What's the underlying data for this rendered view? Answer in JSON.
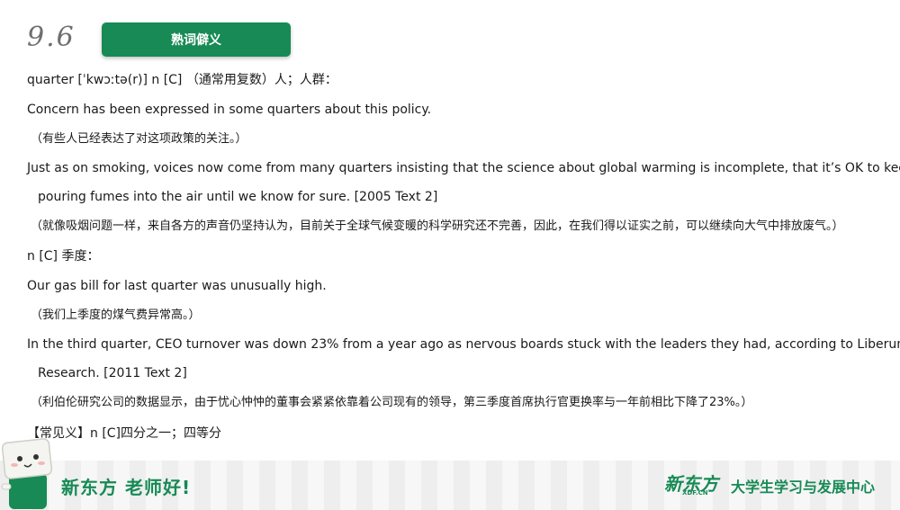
{
  "header": {
    "date": "9.6",
    "badge": "熟词僻义"
  },
  "content": {
    "entry1": "quarter [ˈkwɔːtə(r)] n [C] （通常用复数）人；人群：",
    "ex1_en": "Concern has been expressed in some quarters about this policy.",
    "ex1_cn": "（有些人已经表达了对这项政策的关注。）",
    "ex2_en_1": "Just as on smoking, voices now come from many quarters insisting that the science about global warming is incomplete, that it’s OK to keep",
    "ex2_en_2": "pouring fumes into the air until we know for sure. [2005 Text 2]",
    "ex2_cn": "（就像吸烟问题一样，来自各方的声音仍坚持认为，目前关于全球气候变暖的科学研究还不完善，因此，在我们得以证实之前，可以继续向大气中排放废气。）",
    "entry2": "n [C] 季度：",
    "ex3_en": "Our gas bill for last quarter was unusually high.",
    "ex3_cn": "（我们上季度的煤气费异常高。）",
    "ex4_en_1": "In the third quarter, CEO turnover was down 23% from a year ago as nervous boards stuck with the leaders they had, according to Liberum",
    "ex4_en_2": "Research. [2011 Text 2]",
    "ex4_cn": "（利伯伦研究公司的数据显示，由于忧心忡忡的董事会紧紧依靠着公司现有的领导，第三季度首席执行官更换率与一年前相比下降了23%。）",
    "common": "【常见义】n [C]四分之一；四等分"
  },
  "footer": {
    "slogan": "新东方 老师好!",
    "logo": "新东方",
    "logo_sub": "XDF.CN",
    "center": "大学生学习与发展中心"
  },
  "colors": {
    "brand": "#178a55",
    "date": "#6f6f6f"
  }
}
